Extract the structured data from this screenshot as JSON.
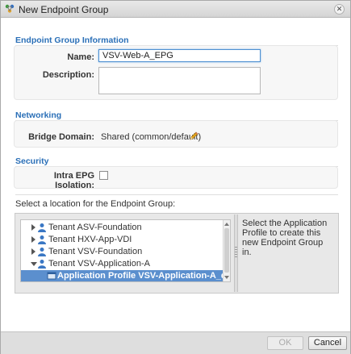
{
  "dialog": {
    "title": "New Endpoint Group",
    "close_glyph": "✕"
  },
  "info": {
    "heading": "Endpoint Group Information",
    "name_label": "Name:",
    "name_value": "VSV-Web-A_EPG",
    "description_label": "Description:",
    "description_value": ""
  },
  "networking": {
    "heading": "Networking",
    "bridge_domain_label": "Bridge Domain:",
    "bridge_domain_value": "Shared (common/default)"
  },
  "security": {
    "heading": "Security",
    "isolation_label": "Intra EPG Isolation:",
    "isolation_checked": false
  },
  "location": {
    "label": "Select a location for the Endpoint Group:",
    "help_text": "Select the Application Profile to create this new Endpoint Group in.",
    "tree": [
      {
        "label": "Tenant ASV-Foundation",
        "expanded": false,
        "icon": "tenant-icon"
      },
      {
        "label": "Tenant HXV-App-VDI",
        "expanded": false,
        "icon": "tenant-icon"
      },
      {
        "label": "Tenant VSV-Foundation",
        "expanded": false,
        "icon": "tenant-icon"
      },
      {
        "label": "Tenant VSV-Application-A",
        "expanded": true,
        "icon": "tenant-icon"
      },
      {
        "label": "Application Profile VSV-Application-A_default",
        "selected": true,
        "icon": "app-profile-icon"
      }
    ]
  },
  "footer": {
    "ok_label": "OK",
    "cancel_label": "Cancel"
  },
  "colors": {
    "section_heading": "#2a6fb7",
    "selection": "#5b8fce",
    "tenant_icon": "#3a77c4"
  }
}
